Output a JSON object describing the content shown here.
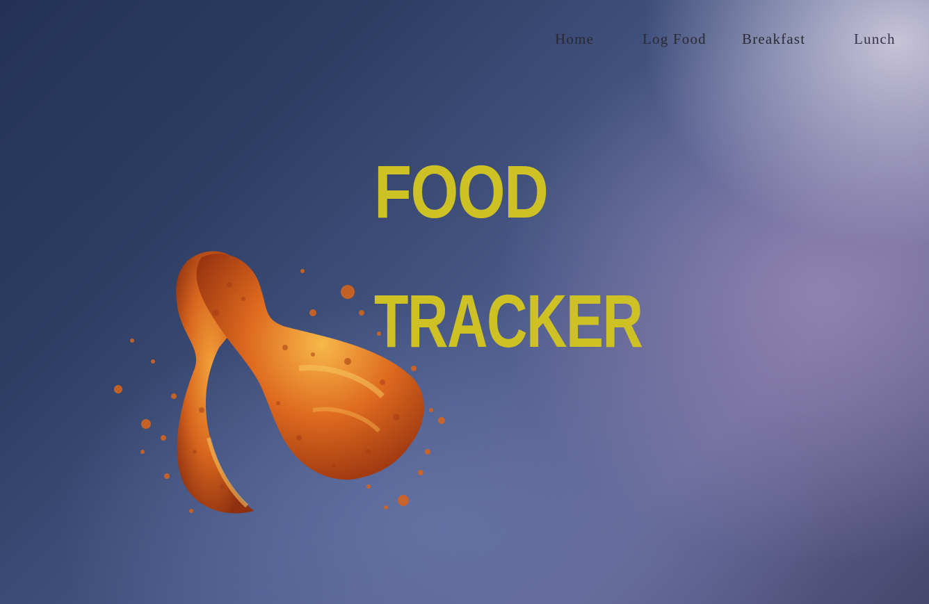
{
  "nav": {
    "items": [
      {
        "label": "Home"
      },
      {
        "label": "Log Food"
      },
      {
        "label": "Breakfast"
      },
      {
        "label": "Lunch"
      }
    ]
  },
  "hero": {
    "title_line_1": "FOOD",
    "title_line_2": "TRACKER",
    "title_color": "#cdc125",
    "image": "fried-chicken-drumsticks-illustration"
  },
  "colors": {
    "background_dark": "#233256",
    "background_light": "#cdc8dc",
    "nav_text": "#2a2a33",
    "chicken_crust": "#c8541a"
  }
}
